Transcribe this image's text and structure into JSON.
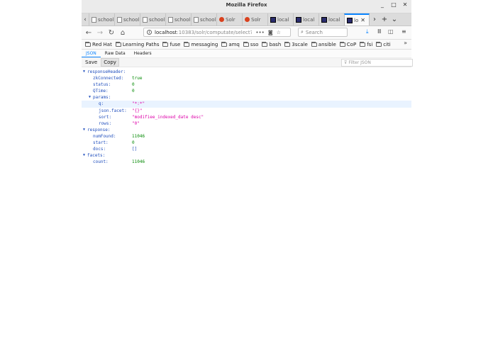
{
  "window": {
    "title": "Mozilla Firefox"
  },
  "tabs": [
    {
      "label": "school.a",
      "icon": "page-icon"
    },
    {
      "label": "school.a",
      "icon": "page-icon"
    },
    {
      "label": "school.a",
      "icon": "page-icon"
    },
    {
      "label": "school.a",
      "icon": "page-icon"
    },
    {
      "label": "school.a",
      "icon": "page-icon"
    },
    {
      "label": "Solr",
      "icon": "solr-icon"
    },
    {
      "label": "Solr",
      "icon": "solr-icon"
    },
    {
      "label": "local",
      "icon": "intellij-icon"
    },
    {
      "label": "local",
      "icon": "intellij-icon"
    },
    {
      "label": "local",
      "icon": "intellij-icon"
    },
    {
      "label": "lo",
      "icon": "intellij-icon",
      "active": true
    }
  ],
  "nav": {
    "url_host": "localhost",
    "url_path": ":10383/solr/computate/select?q=*",
    "more": "•••",
    "search_placeholder": "Search"
  },
  "bookmarks": [
    "Red Hat",
    "Learning Paths",
    "fuse",
    "messaging",
    "amq",
    "sso",
    "bash",
    "3scale",
    "ansible",
    "CoP",
    "fsi",
    "citi"
  ],
  "viewer": {
    "tabs": [
      "JSON",
      "Raw Data",
      "Headers"
    ],
    "save": "Save",
    "copy": "Copy",
    "filter_placeholder": "Filter JSON"
  },
  "json": {
    "responseHeader": {
      "key": "responseHeader:"
    },
    "zkConnected": {
      "key": "zkConnected:",
      "value": "true"
    },
    "status": {
      "key": "status:",
      "value": "0"
    },
    "QTime": {
      "key": "QTime:",
      "value": "0"
    },
    "params": {
      "key": "params:"
    },
    "q": {
      "key": "q:",
      "value": "\"*:*\""
    },
    "json_facet": {
      "key": "json.facet:",
      "value": "\"{}\""
    },
    "sort": {
      "key": "sort:",
      "value": "\"modifiee_indexed_date desc\""
    },
    "rows": {
      "key": "rows:",
      "value": "\"0\""
    },
    "response": {
      "key": "response:"
    },
    "numFound": {
      "key": "numFound:",
      "value": "11046"
    },
    "start": {
      "key": "start:",
      "value": "0"
    },
    "docs": {
      "key": "docs:",
      "value": "[]"
    },
    "facets": {
      "key": "facets:"
    },
    "count": {
      "key": "count:",
      "value": "11046"
    }
  },
  "colors": {
    "accent": "#0a84ff",
    "key": "#1f4ebd",
    "string": "#dd00a9",
    "number": "#058a05"
  }
}
